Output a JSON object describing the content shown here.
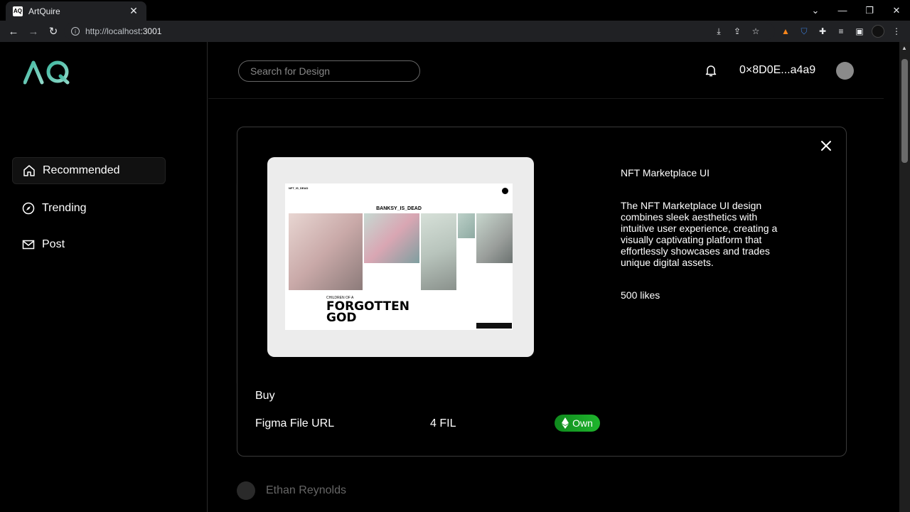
{
  "browser": {
    "tab_title": "ArtQuire",
    "tab_favicon": "AQ",
    "url_host": "http://localhost",
    "url_port": ":3001"
  },
  "app": {
    "logo": "AQ",
    "nav": [
      {
        "label": "Recommended",
        "icon": "home-icon"
      },
      {
        "label": "Trending",
        "icon": "compass-icon"
      },
      {
        "label": "Post",
        "icon": "mail-icon"
      }
    ],
    "search_placeholder": "Search for Design",
    "wallet": "0×8D0E...a4a9",
    "feed_author": "Ethan Reynolds"
  },
  "modal": {
    "title": "NFT Marketplace UI",
    "description": "The NFT Marketplace UI design combines sleek aesthetics with intuitive user experience, creating a visually captivating platform that effortlessly showcases and trades unique digital assets.",
    "likes": "500 likes",
    "buy_label": "Buy",
    "figma_label": "Figma File URL",
    "price": "4 FIL",
    "own_label": "Own",
    "preview": {
      "site_name": "NFT_IS_DEAD",
      "headline": "BANKSY_IS_DEAD",
      "big_text_line1": "FORGOTTEN",
      "big_text_line2": "GOD",
      "small_text": "CHILDREN OF A"
    }
  },
  "colors": {
    "accent_green": "#1fb52d",
    "logo_gradient": [
      "#3fb8a0",
      "#7fd1c3"
    ]
  }
}
